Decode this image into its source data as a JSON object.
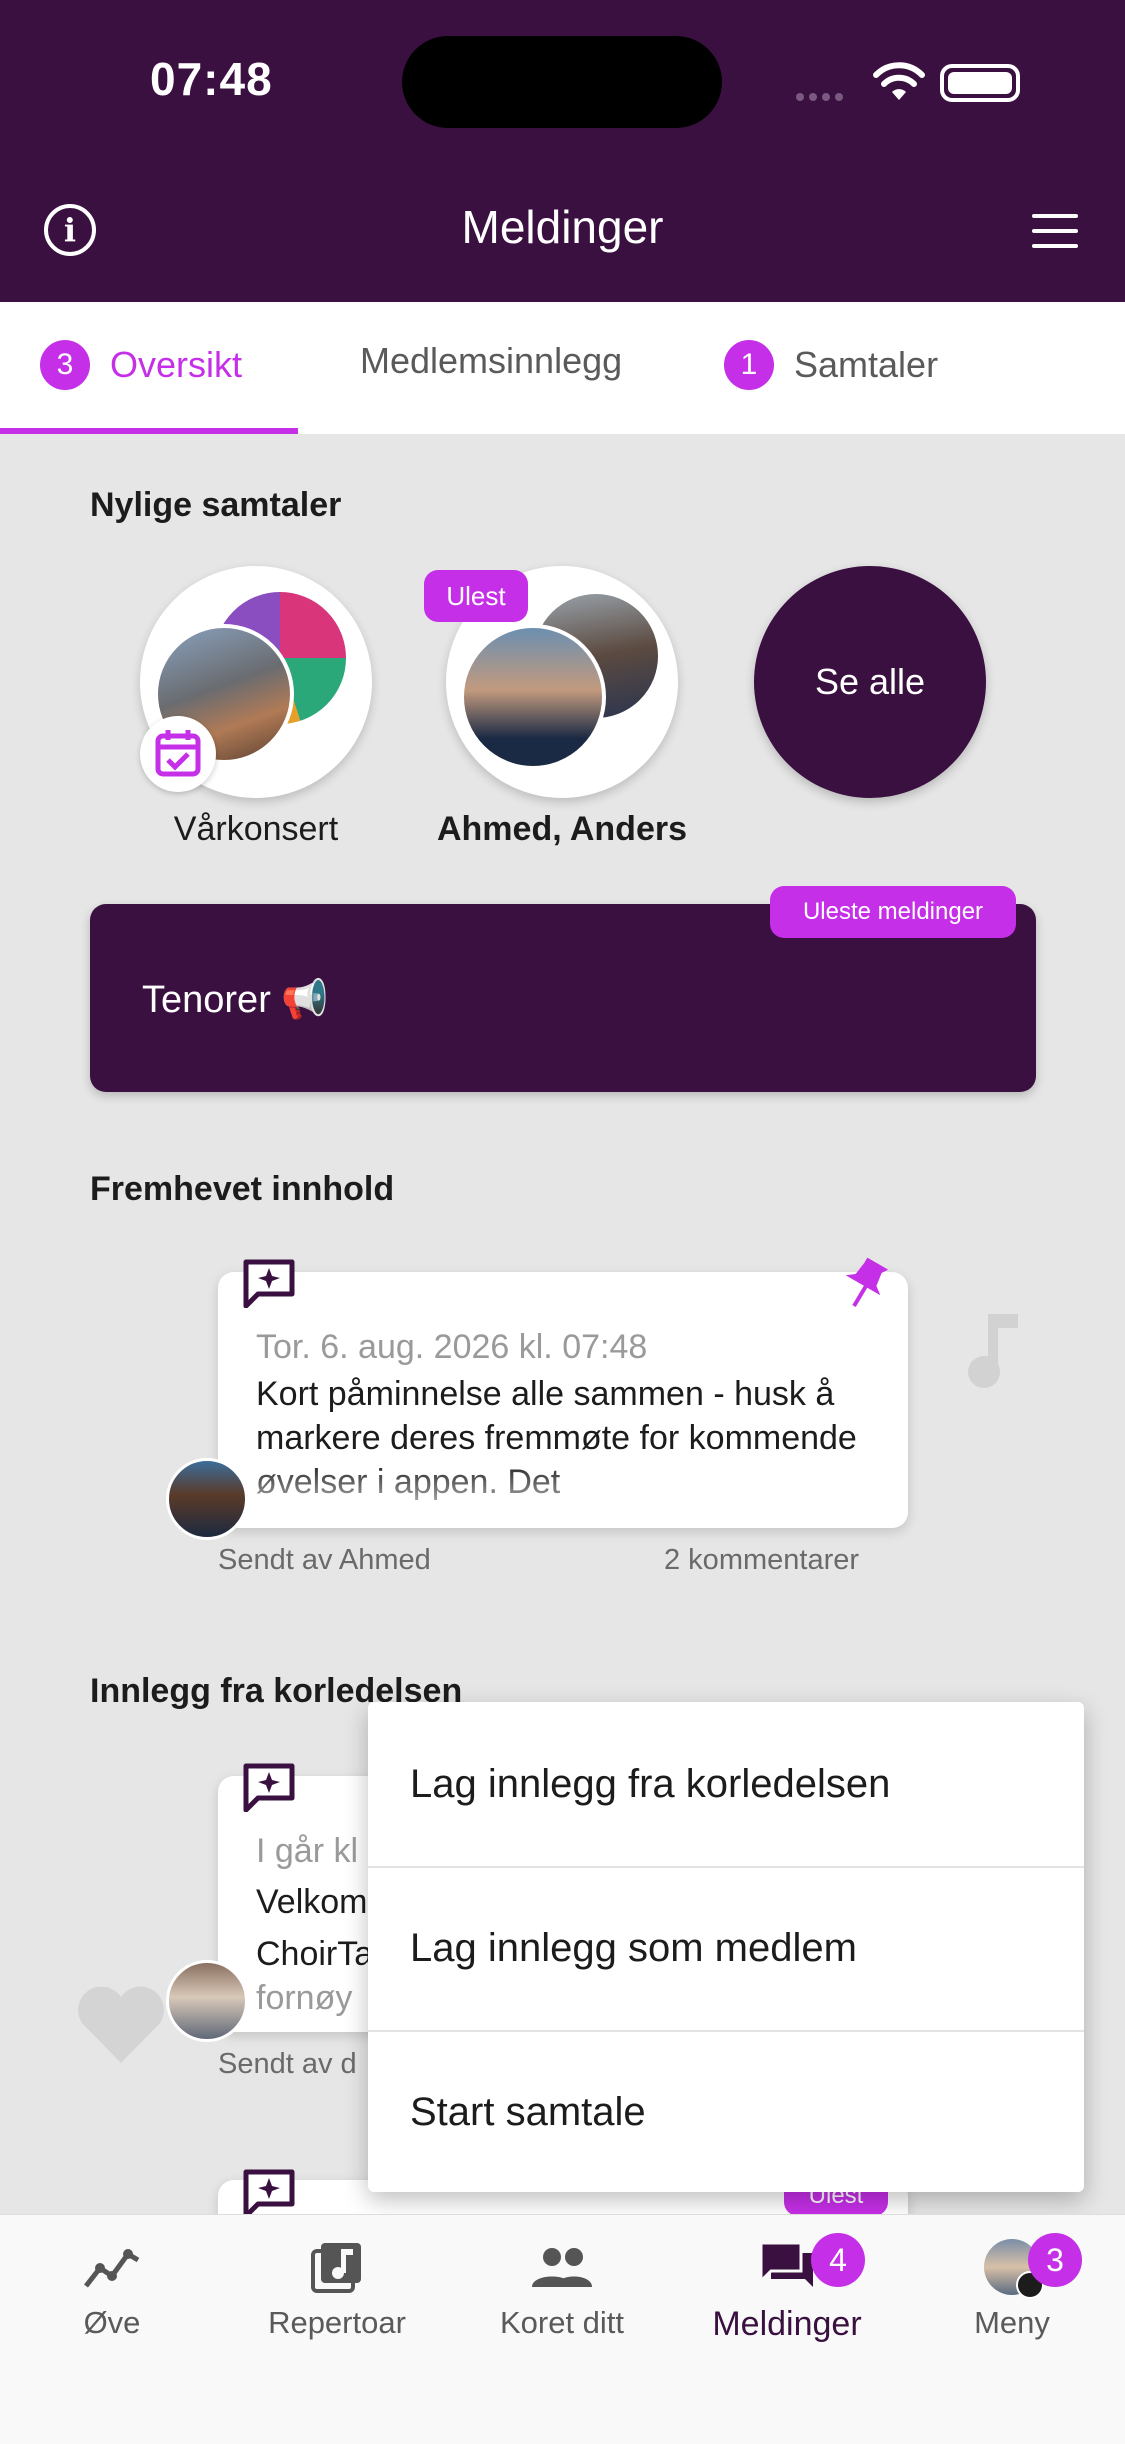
{
  "status_bar": {
    "time": "07:48"
  },
  "header": {
    "title": "Meldinger"
  },
  "tabs": [
    {
      "label": "Oversikt",
      "badge": "3",
      "active": true
    },
    {
      "label": "Medlemsinnlegg",
      "badge": "",
      "active": false
    },
    {
      "label": "Samtaler",
      "badge": "1",
      "active": false
    }
  ],
  "recent": {
    "title": "Nylige samtaler",
    "items": [
      {
        "label": "Vårkonsert",
        "unread_badge": ""
      },
      {
        "label": "Ahmed, Anders",
        "unread_badge": "Ulest"
      }
    ],
    "see_all": "Se alle"
  },
  "group_card": {
    "label": "Tenorer 📢",
    "badge": "Uleste meldinger"
  },
  "featured": {
    "title": "Fremhevet innhold",
    "post": {
      "date": "Tor. 6. aug. 2026 kl. 07:48",
      "body": "Kort påminnelse alle sammen - husk å markere deres fremmøte for kommende øvelser i appen. Det",
      "author": "Sendt av Ahmed",
      "comments": "2 kommentarer"
    }
  },
  "leadership": {
    "title": "Innlegg fra korledelsen",
    "post": {
      "date": "I går kl",
      "line1": "Velkom",
      "line2": "ChoirTa",
      "line3": "fornøy",
      "author": "Sendt av d"
    },
    "next_badge": "Ulest"
  },
  "dropdown": {
    "items": [
      "Lag innlegg fra korledelsen",
      "Lag innlegg som medlem",
      "Start samtale"
    ]
  },
  "bottom_nav": [
    {
      "label": "Øve",
      "icon": "practice-icon",
      "badge": ""
    },
    {
      "label": "Repertoar",
      "icon": "music-library-icon",
      "badge": ""
    },
    {
      "label": "Koret ditt",
      "icon": "people-icon",
      "badge": ""
    },
    {
      "label": "Meldinger",
      "icon": "chat-icon",
      "badge": "4",
      "active": true
    },
    {
      "label": "Meny",
      "icon": "profile-menu-icon",
      "badge": "3"
    }
  ],
  "colors": {
    "primary": "#3a1040",
    "accent": "#c62fe8",
    "background": "#e6e6e6"
  }
}
